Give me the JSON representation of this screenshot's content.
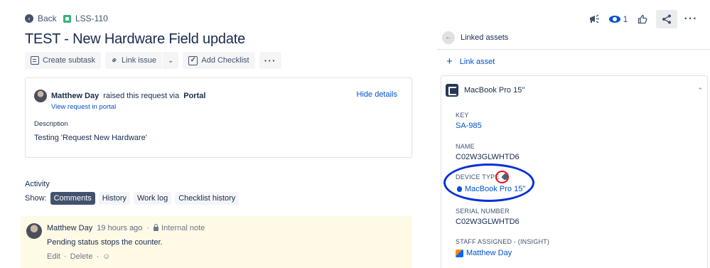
{
  "nav": {
    "back_label": "Back",
    "issue_key": "LSS-110"
  },
  "topbar": {
    "watch_count": "1"
  },
  "issue": {
    "title": "TEST - New Hardware Field update"
  },
  "toolbar": {
    "create_subtask": "Create subtask",
    "link_issue": "Link issue",
    "add_checklist": "Add Checklist"
  },
  "request": {
    "reporter": "Matthew Day",
    "raised_text": "raised this request via",
    "channel": "Portal",
    "hide_details": "Hide details",
    "view_in_portal": "View request in portal",
    "description_label": "Description",
    "description": "Testing 'Request New Hardware'"
  },
  "activity": {
    "heading": "Activity",
    "show_label": "Show:",
    "filters": [
      "Comments",
      "History",
      "Work log",
      "Checklist history"
    ],
    "active_filter": "Comments"
  },
  "comment": {
    "author": "Matthew Day",
    "time": "19 hours ago",
    "visibility": "Internal note",
    "body": "Pending status stops the counter.",
    "edit": "Edit",
    "delete": "Delete"
  },
  "linked_assets": {
    "heading": "Linked assets",
    "link_asset": "Link asset",
    "asset_name": "MacBook Pro 15\"",
    "fields": {
      "key_label": "KEY",
      "key_value": "SA-985",
      "name_label": "NAME",
      "name_value": "C02W3GLWHTD6",
      "device_type_label": "DEVICE TYPE",
      "device_type_value": "MacBook Pro 15\"",
      "serial_label": "SERIAL NUMBER",
      "serial_value": "C02W3GLWHTD6",
      "staff_label": "STAFF ASSIGNED - (INSIGHT)",
      "staff_value": "Matthew Day"
    }
  },
  "colors": {
    "link": "#0052cc",
    "annotation_ellipse": "#0a2fd6",
    "annotation_circle": "#e01818",
    "comment_bg": "#fffae6"
  }
}
